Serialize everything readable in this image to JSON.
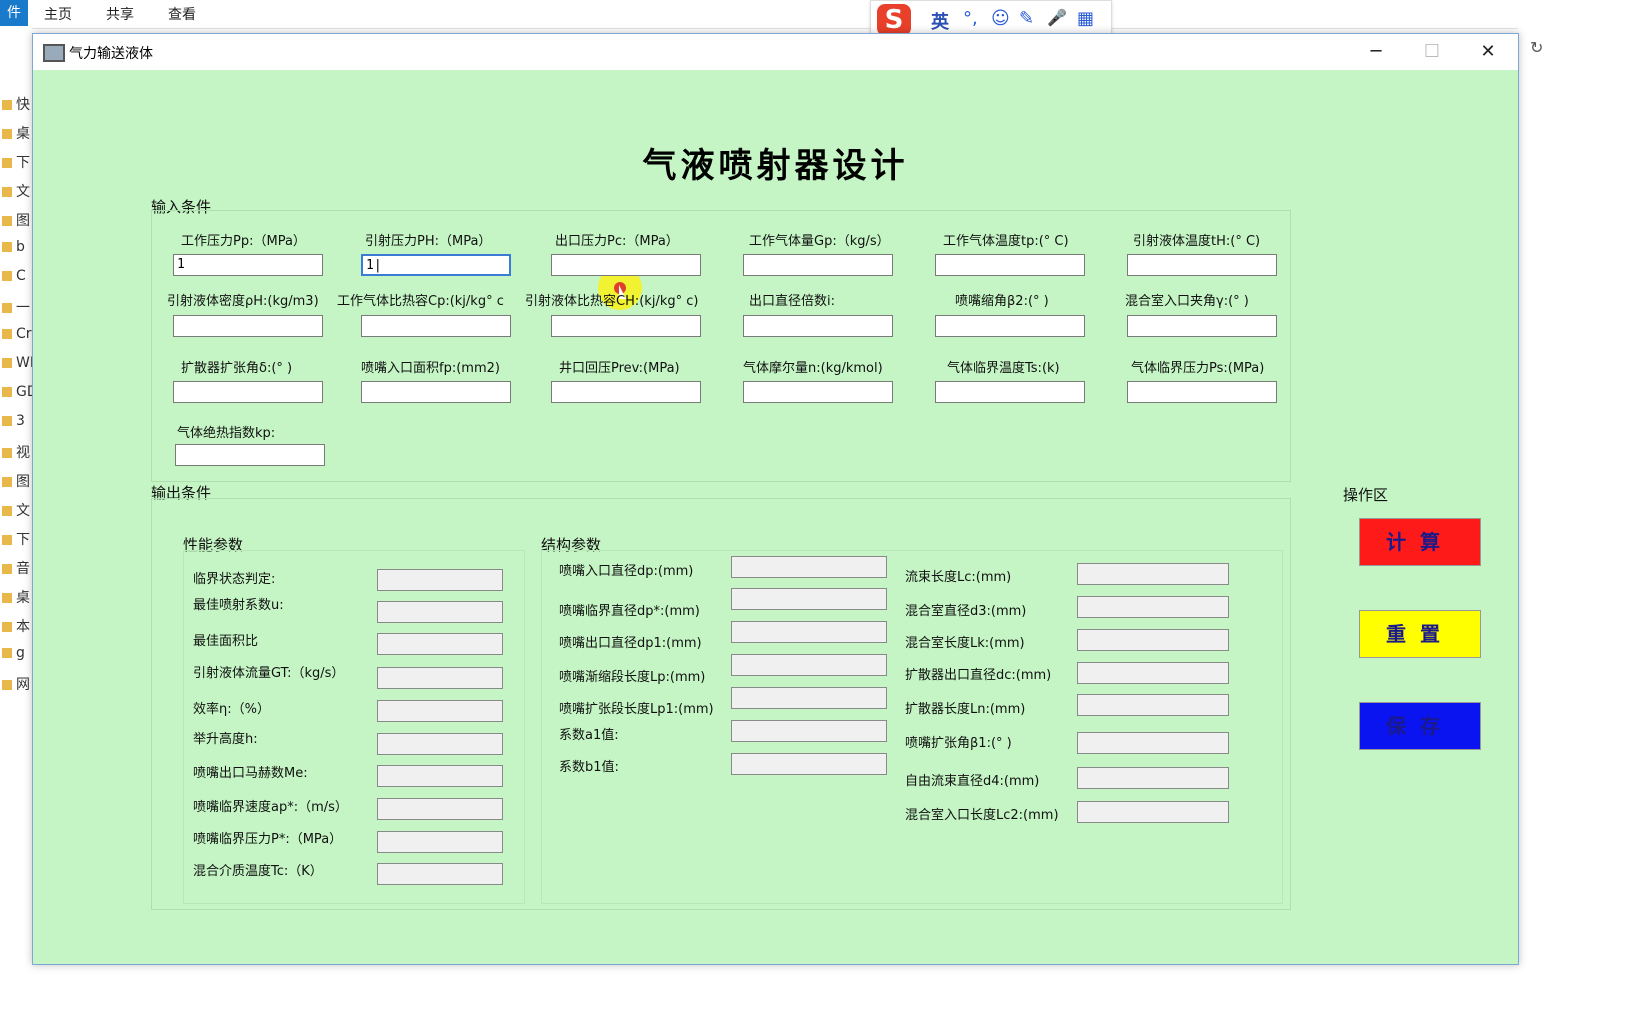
{
  "ribbon": {
    "file_tab": "件",
    "tabs": [
      "主页",
      "共享",
      "查看"
    ]
  },
  "explorer_sidebar": [
    "快",
    "桌",
    "下",
    "文",
    "图",
    "b",
    "C",
    "一",
    "Cr",
    "WI",
    "GD",
    "3",
    "视",
    "图",
    "文",
    "下",
    "音",
    "桌",
    "本",
    "g",
    "网"
  ],
  "ime": {
    "logo": "S",
    "mode": "英",
    "punct": "°,",
    "emoji": "☺",
    "pen": "✎",
    "mic": "🎤",
    "grid": "▦"
  },
  "window": {
    "title": "气力输送液体",
    "minimize": "─",
    "maximize": "☐",
    "close": "✕"
  },
  "main_title": "气液喷射器设计",
  "input_section": {
    "label": "输入条件",
    "fields": [
      {
        "label": "工作压力Pp:（MPa）",
        "value": "1"
      },
      {
        "label": "引射压力PH:（MPa）",
        "value": "1|"
      },
      {
        "label": "出口压力Pc:（MPa）",
        "value": ""
      },
      {
        "label": "工作气体量Gp:（kg/s）",
        "value": ""
      },
      {
        "label": "工作气体温度tp:(° C)",
        "value": ""
      },
      {
        "label": "引射液体温度tH:(° C)",
        "value": ""
      },
      {
        "label": "引射液体密度ρH:(kg/m3)",
        "value": ""
      },
      {
        "label": "工作气体比热容Cp:(kj/kg° c",
        "value": ""
      },
      {
        "label": "引射液体比热容CH:(kj/kg° c)",
        "value": ""
      },
      {
        "label": "出口直径倍数i:",
        "value": ""
      },
      {
        "label": "喷嘴缩角β2:(° )",
        "value": ""
      },
      {
        "label": "混合室入口夹角γ:(° )",
        "value": ""
      },
      {
        "label": "扩散器扩张角δ:(° )",
        "value": ""
      },
      {
        "label": "喷嘴入口面积fp:(mm2)",
        "value": ""
      },
      {
        "label": "井口回压Prev:(MPa)",
        "value": ""
      },
      {
        "label": "气体摩尔量n:(kg/kmol)",
        "value": ""
      },
      {
        "label": "气体临界温度Ts:(k)",
        "value": ""
      },
      {
        "label": "气体临界压力Ps:(MPa)",
        "value": ""
      },
      {
        "label": "气体绝热指数kp:",
        "value": ""
      }
    ]
  },
  "output_section": {
    "label": "输出条件",
    "performance": {
      "label": "性能参数",
      "fields": [
        "临界状态判定:",
        "最佳喷射系数u:",
        "最佳面积比",
        "引射液体流量GT:（kg/s）",
        "效率η:（%）",
        "举升高度h:",
        "喷嘴出口马赫数Me:",
        "喷嘴临界速度ap*:（m/s）",
        "喷嘴临界压力P*:（MPa）",
        "混合介质温度Tc:（K）"
      ]
    },
    "structure": {
      "label": "结构参数",
      "left_fields": [
        "喷嘴入口直径dp:(mm)",
        "喷嘴临界直径dp*:(mm)",
        "喷嘴出口直径dp1:(mm)",
        "喷嘴渐缩段长度Lp:(mm)",
        "喷嘴扩张段长度Lp1:(mm)",
        "系数a1值:",
        "系数b1值:"
      ],
      "right_fields": [
        "流束长度Lc:(mm)",
        "混合室直径d3:(mm)",
        "混合室长度Lk:(mm)",
        "扩散器出口直径dc:(mm)",
        "扩散器长度Ln:(mm)",
        "喷嘴扩张角β1:(° )",
        "自由流束直径d4:(mm)",
        "混合室入口长度Lc2:(mm)"
      ]
    }
  },
  "operation": {
    "label": "操作区",
    "buttons": [
      {
        "label": "计算",
        "color": "#ff1a1a",
        "text_color": "#1a1a8a"
      },
      {
        "label": "重置",
        "color": "#ffff00",
        "text_color": "#1a1a8a"
      },
      {
        "label": "保存",
        "color": "#0a14f0",
        "text_color": "#1a1a8a"
      }
    ]
  }
}
